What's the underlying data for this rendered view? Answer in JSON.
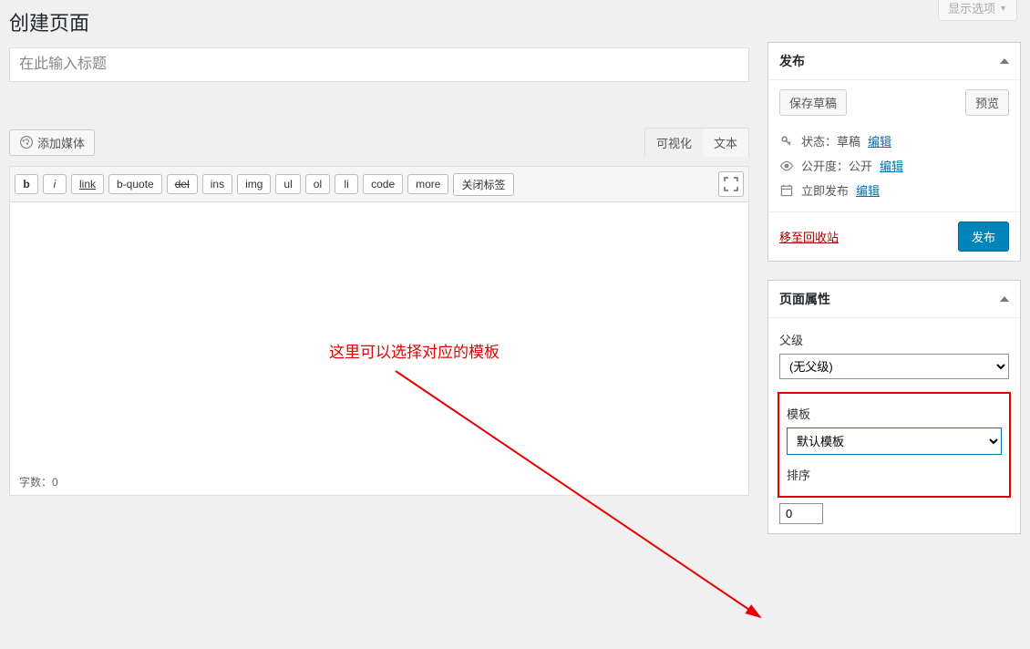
{
  "screenOptionsLabel": "显示选项",
  "pageTitle": "创建页面",
  "titlePlaceholder": "在此输入标题",
  "addMediaLabel": "添加媒体",
  "tabs": {
    "visual": "可视化",
    "text": "文本"
  },
  "toolbar": {
    "b": "b",
    "i": "i",
    "link": "link",
    "bquote": "b-quote",
    "del": "del",
    "ins": "ins",
    "img": "img",
    "ul": "ul",
    "ol": "ol",
    "li": "li",
    "code": "code",
    "more": "more",
    "close": "关闭标签"
  },
  "annotation": "这里可以选择对应的模板",
  "wordCountLabel": "字数：",
  "wordCountValue": "0",
  "publish": {
    "title": "发布",
    "saveDraft": "保存草稿",
    "preview": "预览",
    "statusLabel": "状态：",
    "statusValue": "草稿",
    "statusEdit": "编辑",
    "visibilityLabel": "公开度：",
    "visibilityValue": "公开",
    "visibilityEdit": "编辑",
    "scheduleLabel": "立即发布",
    "scheduleEdit": "编辑",
    "trash": "移至回收站",
    "publishBtn": "发布"
  },
  "attributes": {
    "title": "页面属性",
    "parentLabel": "父级",
    "parentValue": "(无父级)",
    "templateLabel": "模板",
    "templateValue": "默认模板",
    "orderLabel": "排序",
    "orderValue": "0"
  }
}
